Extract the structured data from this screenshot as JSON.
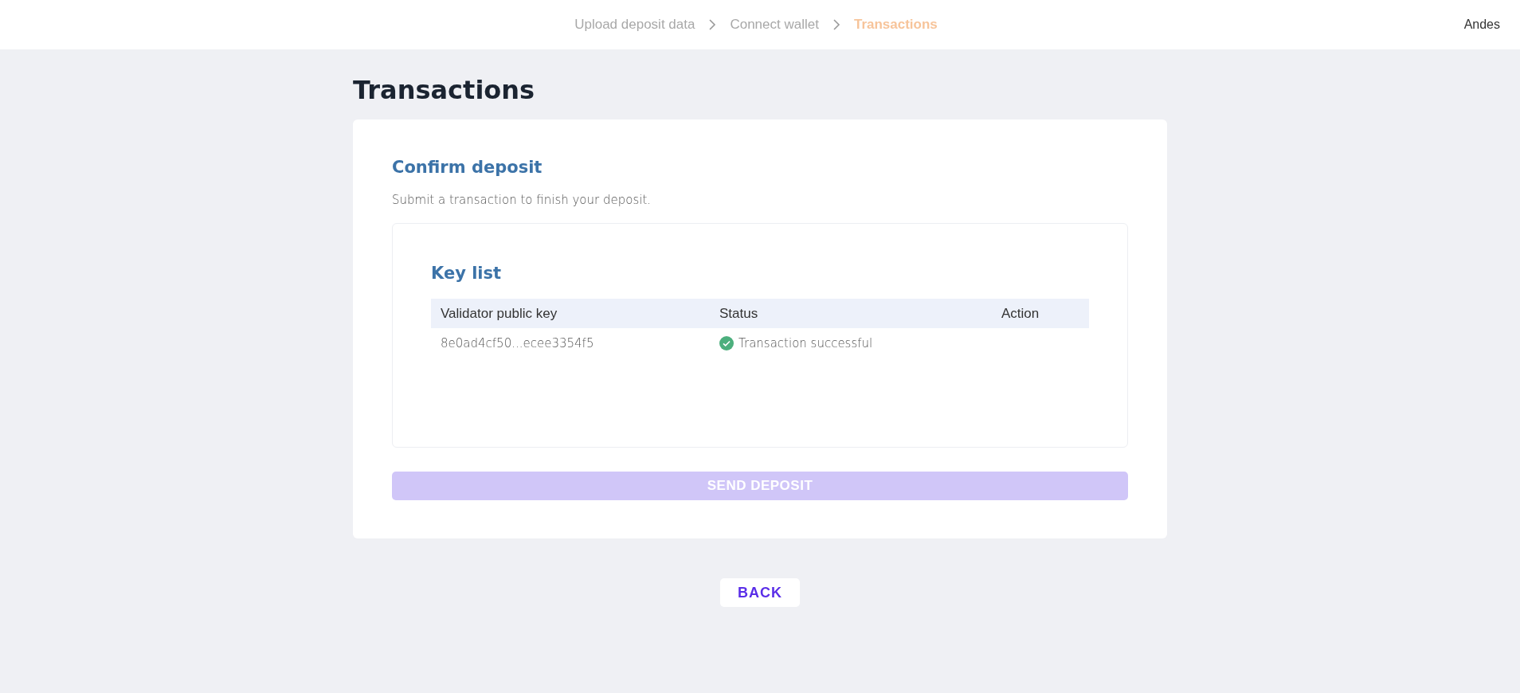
{
  "breadcrumb": [
    {
      "label": "Upload deposit data",
      "selected": false
    },
    {
      "label": "Connect wallet",
      "selected": false
    },
    {
      "label": "Transactions",
      "selected": true
    }
  ],
  "user": "Andes",
  "page_title": "Transactions",
  "card": {
    "title": "Confirm deposit",
    "description": "Submit a transaction to finish your deposit.",
    "key_list": {
      "title": "Key list",
      "columns": [
        "Validator public key",
        "Status",
        "Action"
      ],
      "rows": [
        {
          "key": "8e0ad4cf50...ecee3354f5",
          "status": "Transaction successful",
          "kind": "success"
        }
      ]
    },
    "send_button": {
      "label": "SEND DEPOSIT",
      "disabled": true
    }
  },
  "back_button": "BACK"
}
